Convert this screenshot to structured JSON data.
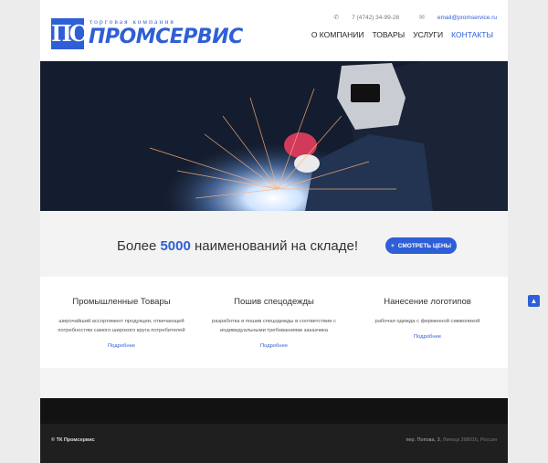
{
  "header": {
    "logo_mark": "ПС",
    "logo_subtitle": "торговая компания",
    "logo_name": "ПРОМСЕРВИС",
    "phone": "7 (4742) 34-99-28",
    "email": "email@promservice.ru",
    "nav": [
      {
        "label": "О КОМПАНИИ"
      },
      {
        "label": "ТОВАРЫ"
      },
      {
        "label": "УСЛУГИ"
      },
      {
        "label": "КОНТАКТЫ",
        "active": true
      }
    ]
  },
  "cta": {
    "prefix": "Более",
    "number": "5000",
    "suffix": "наименований на складе!",
    "button_label": "СМОТРЕТЬ ЦЕНЫ"
  },
  "services": [
    {
      "title": "Промышленные Товары",
      "description": "широчайший ассортимент продукции, отвечающей потребностям самого широкого круга потребителей",
      "more": "Подробнее"
    },
    {
      "title": "Пошив спецодежды",
      "description": "разработка и пошив спецодежды в соответствии с индивидуальными требованиями заказчика",
      "more": "Подробнее"
    },
    {
      "title": "Нанесение логотипов",
      "description": "рабочая одежда с фирменной символикой",
      "more": "Подробнее"
    }
  ],
  "footer": {
    "copyright": "© ТК Промсервис",
    "address_street": "пер. Попова, 3",
    "address_rest": ", Липецк 398016, Россия"
  },
  "colors": {
    "accent": "#2f5fd6",
    "footer": "#1f1f1f"
  }
}
